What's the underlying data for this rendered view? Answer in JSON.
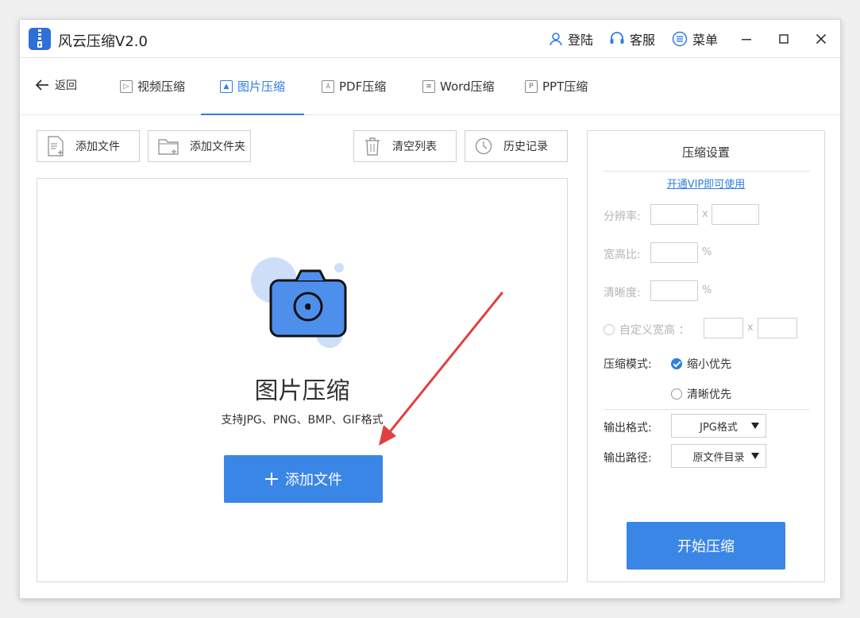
{
  "app": {
    "title": "风云压缩V2.0"
  },
  "titlebar": {
    "login": "登陆",
    "service": "客服",
    "menu": "菜单"
  },
  "nav": {
    "back": "返回",
    "tabs": [
      {
        "label": "视频压缩",
        "icon": "play-icon"
      },
      {
        "label": "图片压缩",
        "icon": "image-icon",
        "active": true
      },
      {
        "label": "PDF压缩",
        "icon": "pdf-icon"
      },
      {
        "label": "Word压缩",
        "icon": "doc-icon"
      },
      {
        "label": "PPT压缩",
        "icon": "ppt-icon"
      }
    ]
  },
  "toolbar": {
    "add_file": "添加文件",
    "add_folder": "添加文件夹",
    "clear_list": "清空列表",
    "history": "历史记录"
  },
  "drop": {
    "title": "图片压缩",
    "subtitle": "支持JPG、PNG、BMP、GIF格式",
    "add_button": "添加文件"
  },
  "settings": {
    "title": "压缩设置",
    "vip_link": "开通VIP即可使用",
    "resolution_label": "分辨率:",
    "resolution_sep": "x",
    "aspect_label": "宽高比:",
    "aspect_unit": "%",
    "clarity_label": "清晰度:",
    "clarity_unit": "%",
    "custom_label": "自定义宽高 ：",
    "custom_sep": "x",
    "mode_label": "压缩模式:",
    "mode_options": [
      "缩小优先",
      "清晰优先"
    ],
    "mode_selected": "缩小优先",
    "format_label": "输出格式:",
    "format_value": "JPG格式",
    "path_label": "输出路径:",
    "path_value": "原文件目录",
    "start_button": "开始压缩"
  },
  "colors": {
    "accent": "#3a86e6",
    "link": "#2f7de1",
    "arrow": "#e04040"
  }
}
